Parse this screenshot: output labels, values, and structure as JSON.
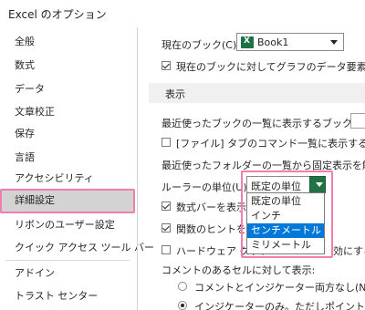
{
  "window": {
    "title": "Excel のオプション"
  },
  "sidebar": {
    "items": [
      {
        "label": "全般"
      },
      {
        "label": "数式"
      },
      {
        "label": "データ"
      },
      {
        "label": "文章校正"
      },
      {
        "label": "保存"
      },
      {
        "label": "言語"
      },
      {
        "label": "アクセシビリティ"
      },
      {
        "label": "詳細設定",
        "selected": true
      },
      {
        "label": "リボンのユーザー設定"
      },
      {
        "label": "クイック アクセス ツール バー"
      },
      {
        "label": "アドイン"
      },
      {
        "label": "トラスト センター"
      }
    ]
  },
  "content": {
    "current_book_label": "現在のブック(C):",
    "current_book_value": "Book1",
    "show_chart_elements_label": "現在のブックに対してグラフのデータ要素に応じて算",
    "display_section_title": "表示",
    "recent_books_label": "最近使ったブックの一覧に表示するブックの数(R):",
    "file_tab_label": "[ファイル] タブのコマンド一覧に表示する、最近使",
    "recent_folders_label": "最近使ったフォルダーの一覧から固定表示を解除する",
    "ruler_units_label": "ルーラーの単位(U)",
    "ruler_units_value": "既定の単位",
    "formula_bar_label": "数式バーを表示す",
    "function_tips_label": "関数のヒントを表",
    "hardware_graphics_label": "ハードウェア グラフ",
    "hardware_graphics_suffix": "効にする",
    "comments_label": "コメントのあるセルに対して表示:",
    "radio_none_label": "コメントとインジケーター両方なし(N)",
    "radio_indicator_label": "インジケーターのみ。ただしポイント時にコメント"
  },
  "dropdown": {
    "options": [
      {
        "label": "既定の単位"
      },
      {
        "label": "インチ"
      },
      {
        "label": "センチメートル",
        "highlighted": true
      },
      {
        "label": "ミリメートル"
      }
    ]
  },
  "colors": {
    "highlight_border": "#f07fb0",
    "selection_blue": "#0078d7",
    "excel_green": "#217346"
  }
}
